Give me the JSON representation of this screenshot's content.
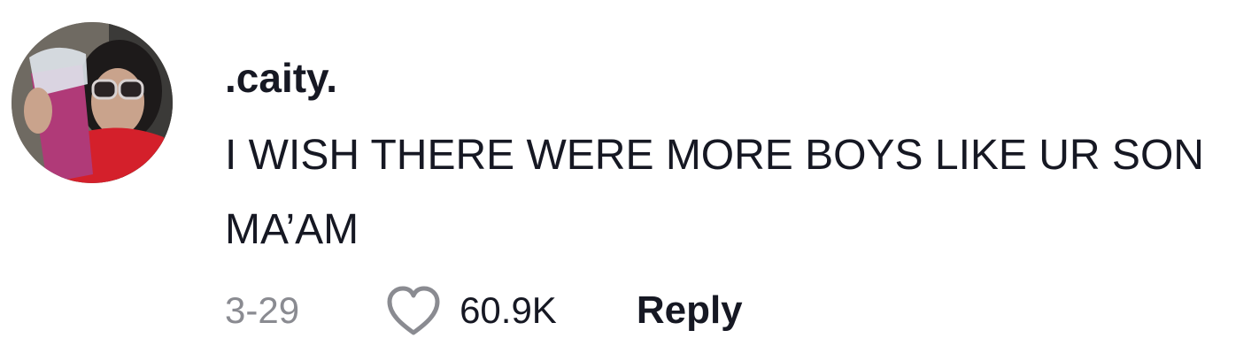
{
  "comment": {
    "avatar_icon": "user-avatar-photo",
    "username": ".caity.",
    "text": "I WISH THERE WERE MORE BOYS LIKE UR SON MA’AM",
    "date": "3-29",
    "like_icon": "heart-outline-icon",
    "like_count": "60.9K",
    "reply_label": "Reply"
  },
  "colors": {
    "text_primary": "#161823",
    "text_secondary": "#8a8b91",
    "background": "#ffffff"
  }
}
